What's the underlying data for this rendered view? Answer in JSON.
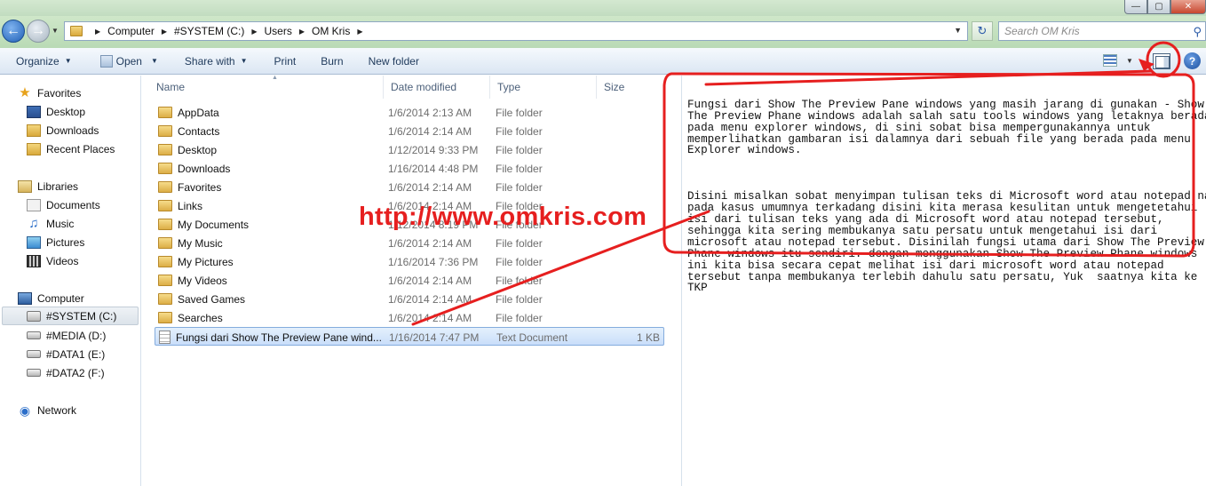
{
  "window": {
    "buttons": {
      "minimize": "—",
      "maximize": "▢",
      "close": "✕"
    }
  },
  "address": {
    "crumbs": [
      "Computer",
      "#SYSTEM (C:)",
      "Users",
      "OM Kris"
    ],
    "search_placeholder": "Search OM Kris"
  },
  "toolbar": {
    "organize": "Organize",
    "open": "Open",
    "share_with": "Share with",
    "print": "Print",
    "burn": "Burn",
    "new_folder": "New folder"
  },
  "nav": {
    "favorites": "Favorites",
    "desktop": "Desktop",
    "downloads": "Downloads",
    "recent_places": "Recent Places",
    "libraries": "Libraries",
    "documents": "Documents",
    "music": "Music",
    "pictures": "Pictures",
    "videos": "Videos",
    "computer": "Computer",
    "drive_c": "#SYSTEM (C:)",
    "drive_d": "#MEDIA (D:)",
    "drive_e": "#DATA1 (E:)",
    "drive_f": "#DATA2 (F:)",
    "network": "Network"
  },
  "columns": {
    "name": "Name",
    "date": "Date modified",
    "type": "Type",
    "size": "Size"
  },
  "files": [
    {
      "name": "AppData",
      "date": "1/6/2014 2:13 AM",
      "type": "File folder",
      "size": ""
    },
    {
      "name": "Contacts",
      "date": "1/6/2014 2:14 AM",
      "type": "File folder",
      "size": ""
    },
    {
      "name": "Desktop",
      "date": "1/12/2014 9:33 PM",
      "type": "File folder",
      "size": ""
    },
    {
      "name": "Downloads",
      "date": "1/16/2014 4:48 PM",
      "type": "File folder",
      "size": ""
    },
    {
      "name": "Favorites",
      "date": "1/6/2014 2:14 AM",
      "type": "File folder",
      "size": ""
    },
    {
      "name": "Links",
      "date": "1/6/2014 2:14 AM",
      "type": "File folder",
      "size": ""
    },
    {
      "name": "My Documents",
      "date": "1/12/2014 8:19 PM",
      "type": "File folder",
      "size": ""
    },
    {
      "name": "My Music",
      "date": "1/6/2014 2:14 AM",
      "type": "File folder",
      "size": ""
    },
    {
      "name": "My Pictures",
      "date": "1/16/2014 7:36 PM",
      "type": "File folder",
      "size": ""
    },
    {
      "name": "My Videos",
      "date": "1/6/2014 2:14 AM",
      "type": "File folder",
      "size": ""
    },
    {
      "name": "Saved Games",
      "date": "1/6/2014 2:14 AM",
      "type": "File folder",
      "size": ""
    },
    {
      "name": "Searches",
      "date": "1/6/2014 2:14 AM",
      "type": "File folder",
      "size": ""
    },
    {
      "name": "Fungsi dari Show The Preview Pane wind...",
      "date": "1/16/2014 7:47 PM",
      "type": "Text Document",
      "size": "1 KB"
    }
  ],
  "preview": {
    "paragraph1": "Fungsi dari Show The Preview Pane windows yang masih jarang di gunakan - Show The Preview Phane windows adalah salah satu tools windows yang letaknya berada pada menu explorer windows, di sini sobat bisa mempergunakannya untuk memperlihatkan gambaran isi dalamnya dari sebuah file yang berada pada menu Explorer windows.",
    "paragraph2": "Disini misalkan sobat menyimpan tulisan teks di Microsoft word atau notepad nah pada kasus umumnya terkadang disini kita merasa kesulitan untuk mengetetahui isi dari tulisan teks yang ada di Microsoft word atau notepad tersebut, sehingga kita sering membukanya satu persatu untuk mengetahui isi dari microsoft atau notepad tersebut. Disinilah fungsi utama dari Show The Preview Phane windows itu sendiri. dengan menggunakan Show The Preview Phane windows ini kita bisa secara cepat melihat isi dari microsoft word atau notepad tersebut tanpa membukanya terlebih dahulu satu persatu, Yuk  saatnya kita ke TKP"
  },
  "watermark": "http://www.omkris.com",
  "colors": {
    "annotation": "#e61f1f",
    "selection": "#c9defa",
    "toolbar_text": "#1e395b"
  }
}
